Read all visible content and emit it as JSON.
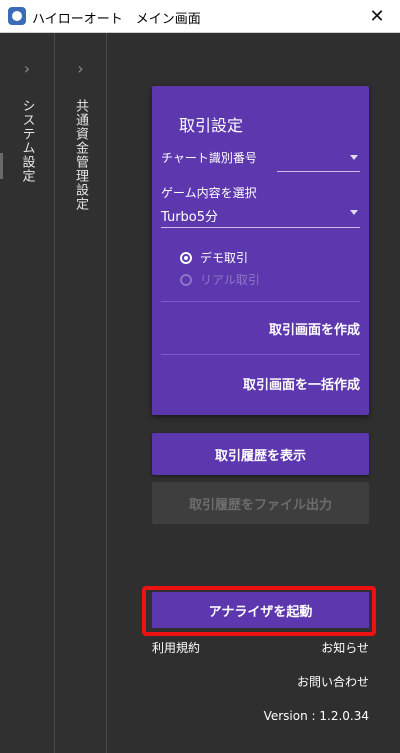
{
  "window": {
    "title": "ハイローオート　メイン画面",
    "close_glyph": "✕"
  },
  "side_tabs": [
    {
      "label": "システム設定",
      "chevron": "›"
    },
    {
      "label": "共通資金管理設定",
      "chevron": "›"
    }
  ],
  "card": {
    "title": "取引設定",
    "chart_id_label": "チャート識別番号",
    "chart_id_value": "",
    "game_label": "ゲーム内容を選択",
    "game_value": "Turbo5分",
    "radio_demo": "デモ取引",
    "radio_real": "リアル取引",
    "create_label": "取引画面を作成",
    "create_all_label": "取引画面を一括作成"
  },
  "buttons": {
    "history": "取引履歴を表示",
    "export": "取引履歴をファイル出力",
    "analyzer": "アナライザを起動"
  },
  "footer": {
    "terms": "利用規約",
    "news": "お知らせ",
    "contact": "お問い合わせ",
    "version": "Version : 1.2.0.34"
  },
  "colors": {
    "accent": "#5d37ae",
    "highlight": "#ee1111",
    "background": "#2f2f2f"
  }
}
